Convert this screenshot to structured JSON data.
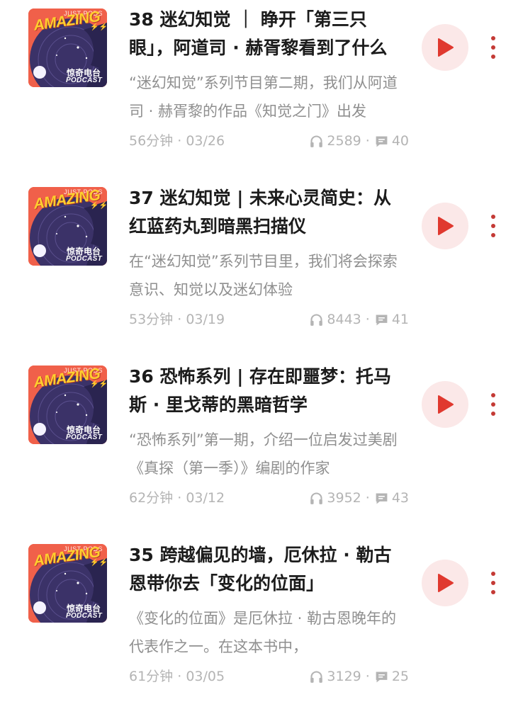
{
  "cover": {
    "top_tag": "JUST PODS",
    "logo": "AMAZING",
    "logo_marks": "⚡⚡⚡",
    "brand_cn": "惊奇电台",
    "brand_en": "PODCAST"
  },
  "icons": {
    "play": "play-icon",
    "more": "more-vertical-icon",
    "plays": "headphones-icon",
    "comments": "comment-icon"
  },
  "colors": {
    "play_bg": "#fbe8e8",
    "play_triangle": "#e0392f",
    "more_dots": "#c43a35",
    "cover_bg": "#f0604a",
    "cover_circle": "#3b3268"
  },
  "episodes": [
    {
      "title": "38 迷幻知觉 ｜ 睁开「第三只眼」，阿道司 · 赫胥黎看到了什么",
      "desc": "“迷幻知觉”系列节目第二期，我们从阿道司 · 赫胥黎的作品《知觉之门》出发",
      "duration": "56分钟",
      "date": "03/26",
      "plays": "2589",
      "comments": "40"
    },
    {
      "title": "37 迷幻知觉 | 未来心灵简史：从红蓝药丸到暗黑扫描仪",
      "desc": "在“迷幻知觉”系列节目里，我们将会探索意识、知觉以及迷幻体验",
      "duration": "53分钟",
      "date": "03/19",
      "plays": "8443",
      "comments": "41"
    },
    {
      "title": "36 恐怖系列 | 存在即噩梦：托马斯 · 里戈蒂的黑暗哲学",
      "desc": "“恐怖系列”第一期，介绍一位启发过美剧《真探（第一季）》编剧的作家",
      "duration": "62分钟",
      "date": "03/12",
      "plays": "3952",
      "comments": "43"
    },
    {
      "title": "35 跨越偏见的墙，厄休拉 · 勒古恩带你去「变化的位面」",
      "desc": "《变化的位面》是厄休拉 · 勒古恩晚年的代表作之一。在这本书中，",
      "duration": "61分钟",
      "date": "03/05",
      "plays": "3129",
      "comments": "25"
    }
  ]
}
